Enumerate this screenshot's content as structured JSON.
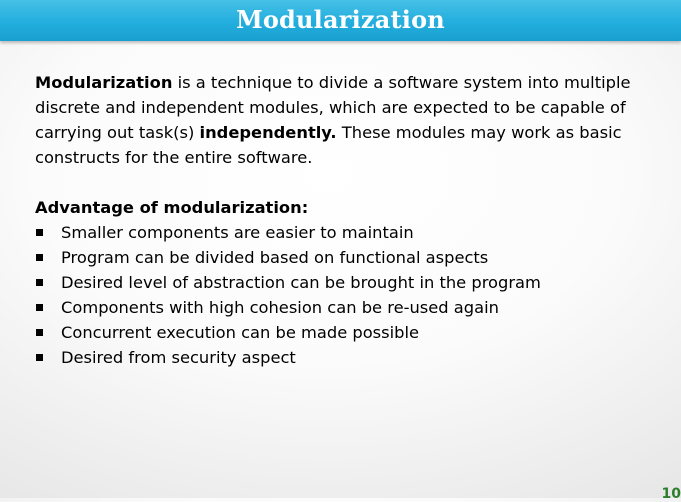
{
  "slide": {
    "title": "Modularization",
    "intro": {
      "lead_bold": "Modularization",
      "text_1": " is a technique to divide a software system into multiple discrete and independent modules, which are expected to be capable of carrying out task(s) ",
      "emphasis_bold": "independently.",
      "text_2": " These modules may work as basic constructs for the entire software."
    },
    "advantages": {
      "heading": "Advantage of modularization:",
      "items": [
        "Smaller components are easier to maintain",
        "Program can be divided based on functional aspects",
        "Desired level of abstraction can be brought in the program",
        "Components with high cohesion can be re-used again",
        "Concurrent execution can be made possible",
        "Desired from security aspect"
      ]
    },
    "page_number": "10"
  }
}
